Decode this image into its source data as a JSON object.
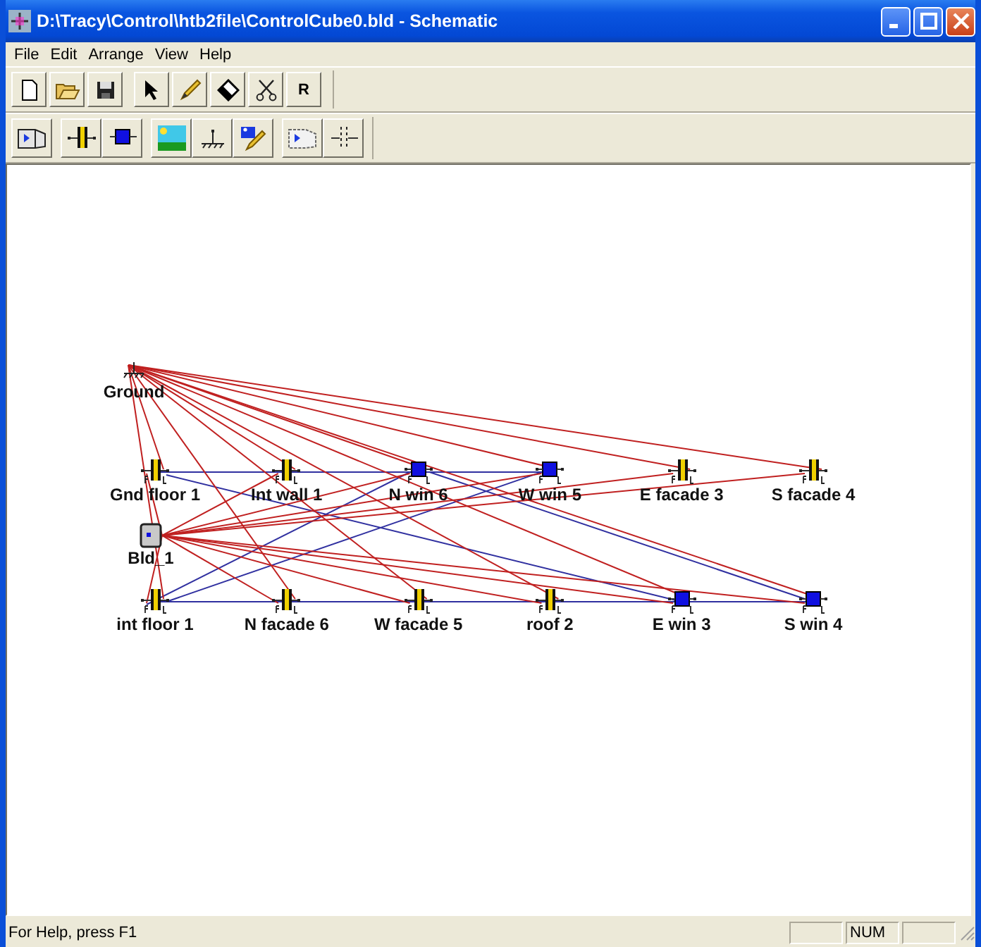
{
  "window": {
    "title": "D:\\Tracy\\Control\\htb2file\\ControlCube0.bld - Schematic"
  },
  "menu": [
    "File",
    "Edit",
    "Arrange",
    "View",
    "Help"
  ],
  "toolbar": {
    "text_button": "R"
  },
  "schematic": {
    "rows": [
      {
        "nodes": [
          {
            "label": "Ground",
            "kind": "ground"
          }
        ]
      },
      {
        "nodes": [
          {
            "label": "Gnd floor 1",
            "kind": "wall"
          },
          {
            "label": "Int wall 1",
            "kind": "wall"
          },
          {
            "label": "N win 6",
            "kind": "window"
          },
          {
            "label": "W win 5",
            "kind": "window"
          },
          {
            "label": "E facade 3",
            "kind": "wall"
          },
          {
            "label": "S facade 4",
            "kind": "wall"
          }
        ]
      },
      {
        "nodes": [
          {
            "label": "Bld_1",
            "kind": "building"
          }
        ]
      },
      {
        "nodes": [
          {
            "label": "int floor 1",
            "kind": "wall"
          },
          {
            "label": "N facade 6",
            "kind": "wall"
          },
          {
            "label": "W facade 5",
            "kind": "wall"
          },
          {
            "label": "roof 2",
            "kind": "wall"
          },
          {
            "label": "E win 3",
            "kind": "window"
          },
          {
            "label": "S win 4",
            "kind": "window"
          }
        ]
      }
    ]
  },
  "status_bar": {
    "message": "For Help, press F1",
    "panes": [
      "NUM"
    ]
  }
}
